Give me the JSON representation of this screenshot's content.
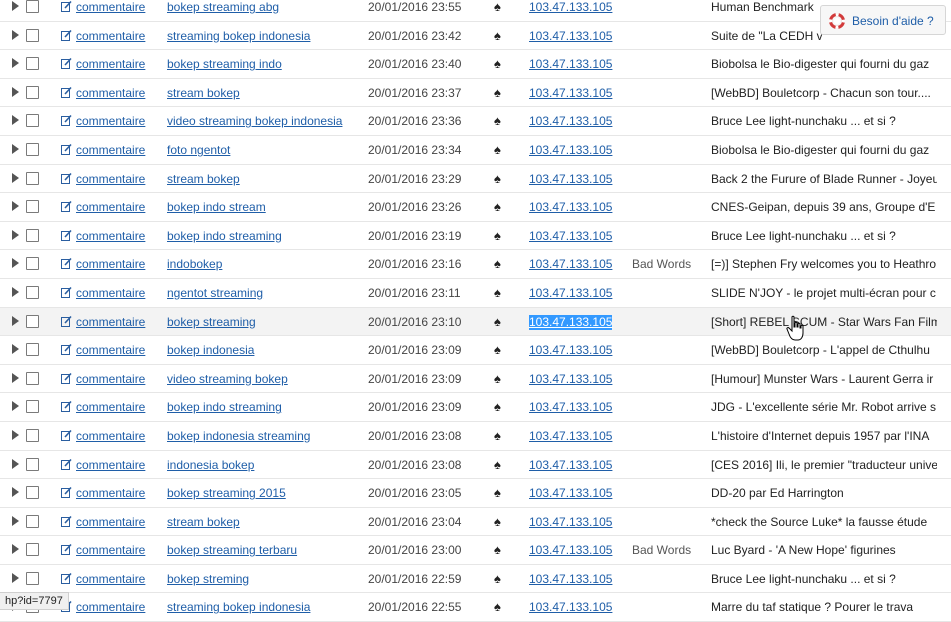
{
  "help": {
    "label": "Besoin d'aide ?"
  },
  "status_url": "hp?id=7797",
  "rows": [
    {
      "action": "commentaire",
      "keyword": "bokep streaming abg",
      "date": "20/01/2016 23:55",
      "ip": "103.47.133.105",
      "flag": "",
      "title": "Human Benchmark"
    },
    {
      "action": "commentaire",
      "keyword": "streaming bokep indonesia",
      "date": "20/01/2016 23:42",
      "ip": "103.47.133.105",
      "flag": "",
      "title": "Suite de \"La CEDH v"
    },
    {
      "action": "commentaire",
      "keyword": "bokep streaming indo",
      "date": "20/01/2016 23:40",
      "ip": "103.47.133.105",
      "flag": "",
      "title": "Biobolsa le Bio-digester qui fourni du gaz"
    },
    {
      "action": "commentaire",
      "keyword": "stream bokep",
      "date": "20/01/2016 23:37",
      "ip": "103.47.133.105",
      "flag": "",
      "title": "[WebBD] Bouletcorp - Chacun son tour...."
    },
    {
      "action": "commentaire",
      "keyword": "video streaming bokep indonesia",
      "date": "20/01/2016 23:36",
      "ip": "103.47.133.105",
      "flag": "",
      "title": "Bruce Lee light-nunchaku ... et si ?"
    },
    {
      "action": "commentaire",
      "keyword": "foto ngentot",
      "date": "20/01/2016 23:34",
      "ip": "103.47.133.105",
      "flag": "",
      "title": "Biobolsa le Bio-digester qui fourni du gaz"
    },
    {
      "action": "commentaire",
      "keyword": "stream bokep",
      "date": "20/01/2016 23:29",
      "ip": "103.47.133.105",
      "flag": "",
      "title": "Back 2 the Furure of Blade Runner - Joyeu"
    },
    {
      "action": "commentaire",
      "keyword": "bokep indo stream",
      "date": "20/01/2016 23:26",
      "ip": "103.47.133.105",
      "flag": "",
      "title": "CNES-Geipan, depuis 39 ans, Groupe d'E"
    },
    {
      "action": "commentaire",
      "keyword": "bokep indo streaming",
      "date": "20/01/2016 23:19",
      "ip": "103.47.133.105",
      "flag": "",
      "title": "Bruce Lee light-nunchaku ... et si ?"
    },
    {
      "action": "commentaire",
      "keyword": "indobokep",
      "date": "20/01/2016 23:16",
      "ip": "103.47.133.105",
      "flag": "Bad Words",
      "title": "[=)] Stephen Fry welcomes you to Heathro"
    },
    {
      "action": "commentaire",
      "keyword": "ngentot streaming",
      "date": "20/01/2016 23:11",
      "ip": "103.47.133.105",
      "flag": "",
      "title": "SLIDE N'JOY - le projet multi-écran pour c"
    },
    {
      "action": "commentaire",
      "keyword": "bokep streaming",
      "date": "20/01/2016 23:10",
      "ip": "103.47.133.105",
      "flag": "",
      "title": "[Short] REBEL SCUM - Star Wars Fan Film",
      "highlight": true,
      "ip_selected": true
    },
    {
      "action": "commentaire",
      "keyword": "bokep indonesia",
      "date": "20/01/2016 23:09",
      "ip": "103.47.133.105",
      "flag": "",
      "title": "[WebBD] Bouletcorp - L'appel de Cthulhu"
    },
    {
      "action": "commentaire",
      "keyword": "video streaming bokep",
      "date": "20/01/2016 23:09",
      "ip": "103.47.133.105",
      "flag": "",
      "title": "[Humour] Munster Wars - Laurent Gerra ir"
    },
    {
      "action": "commentaire",
      "keyword": "bokep indo streaming",
      "date": "20/01/2016 23:09",
      "ip": "103.47.133.105",
      "flag": "",
      "title": "JDG - L'excellente série Mr. Robot arrive s"
    },
    {
      "action": "commentaire",
      "keyword": "bokep indonesia streaming",
      "date": "20/01/2016 23:08",
      "ip": "103.47.133.105",
      "flag": "",
      "title": "L'histoire d'Internet depuis 1957 par l'INA"
    },
    {
      "action": "commentaire",
      "keyword": "indonesia bokep",
      "date": "20/01/2016 23:08",
      "ip": "103.47.133.105",
      "flag": "",
      "title": "[CES 2016] Ili, le premier \"traducteur unive"
    },
    {
      "action": "commentaire",
      "keyword": "bokep streaming 2015",
      "date": "20/01/2016 23:05",
      "ip": "103.47.133.105",
      "flag": "",
      "title": "DD-20 par Ed Harrington"
    },
    {
      "action": "commentaire",
      "keyword": "stream bokep",
      "date": "20/01/2016 23:04",
      "ip": "103.47.133.105",
      "flag": "",
      "title": "*check the Source Luke* la fausse étude"
    },
    {
      "action": "commentaire",
      "keyword": "bokep streaming terbaru",
      "date": "20/01/2016 23:00",
      "ip": "103.47.133.105",
      "flag": "Bad Words",
      "title": "Luc Byard - 'A New Hope' figurines"
    },
    {
      "action": "commentaire",
      "keyword": "bokep streming",
      "date": "20/01/2016 22:59",
      "ip": "103.47.133.105",
      "flag": "",
      "title": "Bruce Lee light-nunchaku ... et si ?"
    },
    {
      "action": "commentaire",
      "keyword": "streaming bokep indonesia",
      "date": "20/01/2016 22:55",
      "ip": "103.47.133.105",
      "flag": "",
      "title": "Marre du taf statique ? Pourer le trava"
    }
  ]
}
